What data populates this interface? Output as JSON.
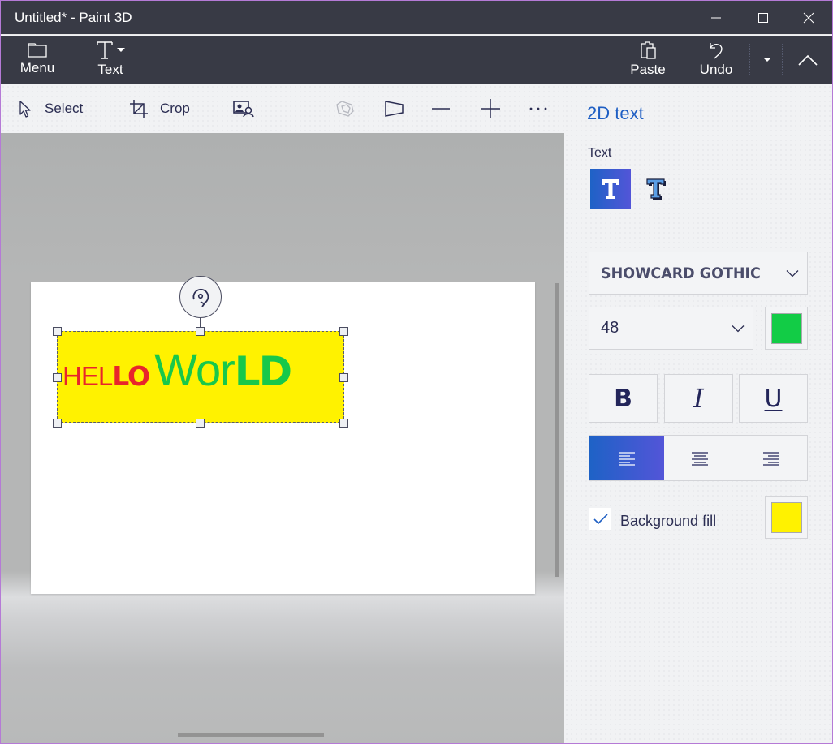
{
  "window": {
    "title": "Untitled* - Paint 3D",
    "controls": {
      "minimize": "minimize",
      "maximize": "maximize",
      "close": "close"
    }
  },
  "ribbon": {
    "menu_label": "Menu",
    "text_label": "Text",
    "paste_label": "Paste",
    "undo_label": "Undo"
  },
  "toolbar": {
    "select_label": "Select",
    "crop_label": "Crop"
  },
  "canvas": {
    "text_parts": [
      "HEL",
      "LO",
      "Wor",
      "LD"
    ],
    "text_colors": {
      "hello": "#e8252b",
      "world": "#18c84a"
    },
    "background_fill": "#fff200"
  },
  "panel": {
    "title": "2D text",
    "text_section_label": "Text",
    "font_family": "Showcard Gothic",
    "font_size": "48",
    "text_color": "#12cc46",
    "bold_label": "B",
    "italic_label": "I",
    "underline_label": "U",
    "alignment_selected": "left",
    "background_fill_label": "Background fill",
    "background_fill_checked": true,
    "background_fill_color": "#fff200"
  },
  "theme": {
    "accent": "#1f5fc4",
    "titlebar": "#383a45"
  }
}
